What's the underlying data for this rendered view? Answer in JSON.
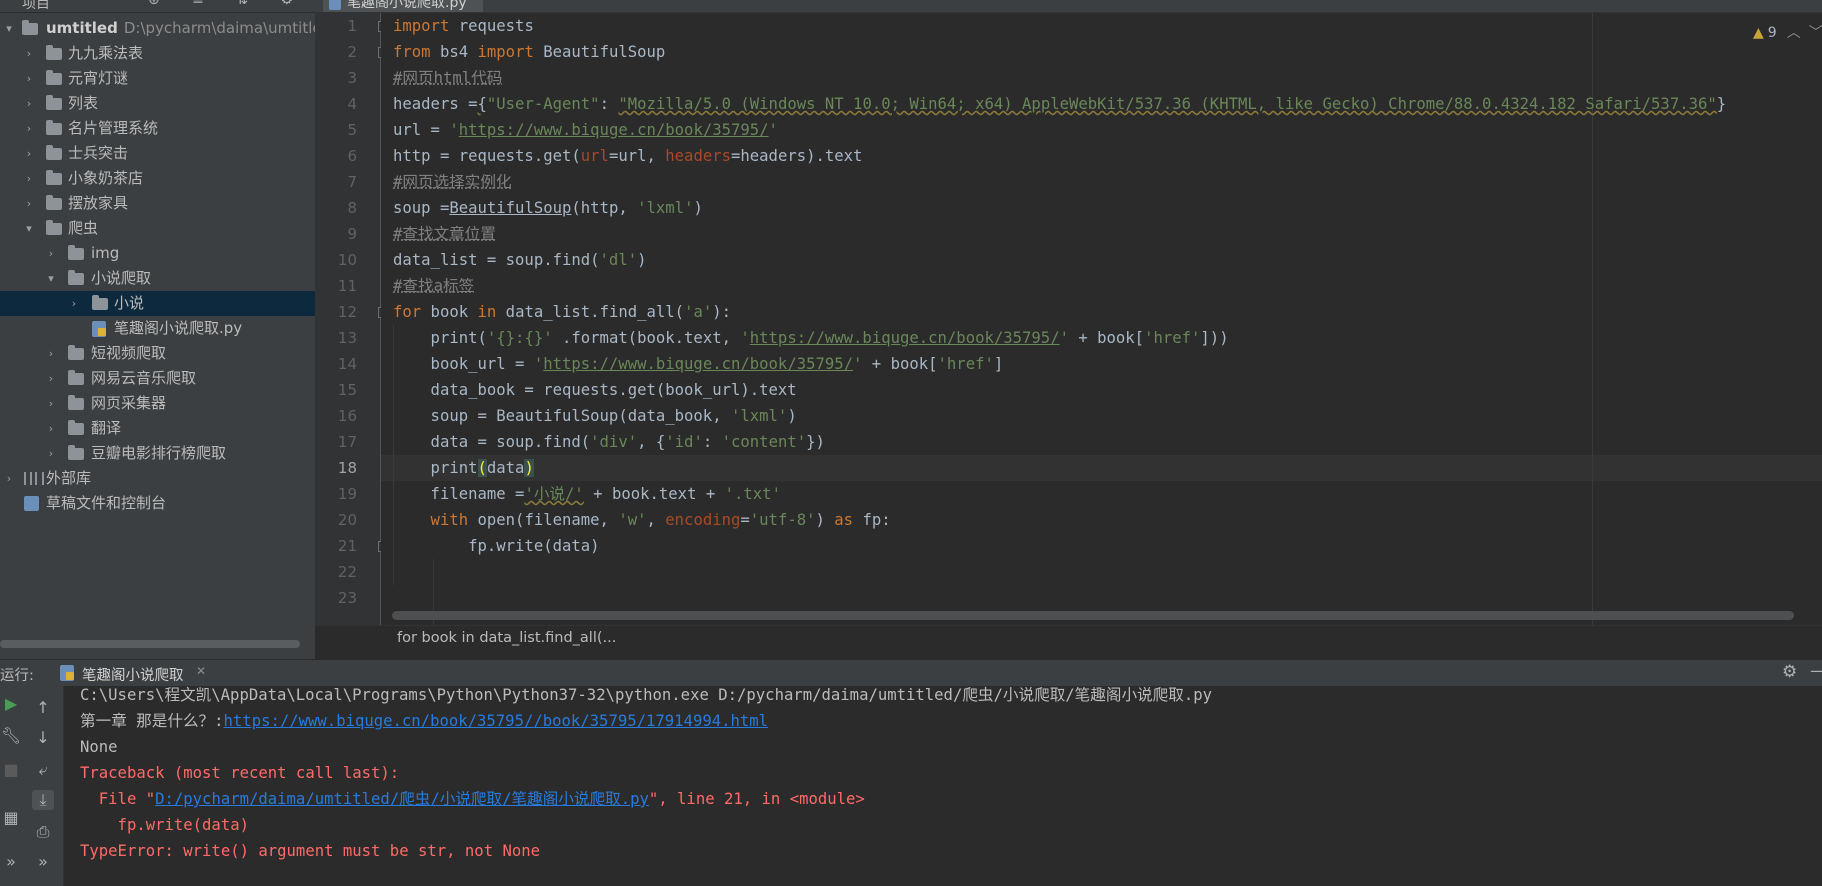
{
  "project": {
    "header_label": "项目",
    "header_icons": "⊕ ≡ ⇅ ⚙ —",
    "root_name": "umtitled",
    "root_path": "D:\\pycharm\\daima\\umtitled",
    "items": [
      {
        "label": "九九乘法表"
      },
      {
        "label": "元宵灯谜"
      },
      {
        "label": "列表"
      },
      {
        "label": "名片管理系统"
      },
      {
        "label": "士兵突击"
      },
      {
        "label": "小象奶茶店"
      },
      {
        "label": "摆放家具"
      },
      {
        "label": "爬虫"
      },
      {
        "label": "img"
      },
      {
        "label": "小说爬取"
      },
      {
        "label": "小说"
      },
      {
        "label": "笔趣阁小说爬取.py"
      },
      {
        "label": "短视频爬取"
      },
      {
        "label": "网易云音乐爬取"
      },
      {
        "label": "网页采集器"
      },
      {
        "label": "翻译"
      },
      {
        "label": "豆瓣电影排行榜爬取"
      },
      {
        "label": "外部库"
      },
      {
        "label": "草稿文件和控制台"
      }
    ]
  },
  "editor": {
    "tab_label": "笔趣阁小说爬取.py",
    "inspection_count": "9",
    "current_line": 18,
    "line_numbers": [
      "1",
      "2",
      "3",
      "4",
      "5",
      "6",
      "7",
      "8",
      "9",
      "10",
      "11",
      "12",
      "13",
      "14",
      "15",
      "16",
      "17",
      "18",
      "19",
      "20",
      "21",
      "22",
      "23"
    ],
    "code": {
      "l1_kw": "import",
      "l1_rest": " requests",
      "l2_kw1": "from",
      "l2_mid": " bs4 ",
      "l2_kw2": "import",
      "l2_rest": " BeautifulSoup",
      "l3": "#网页html代码",
      "l4_a": "headers =",
      "l4_b": "{",
      "l4_key": "\"User-Agent\"",
      "l4_c": ": ",
      "l4_val": "\"Mozilla/5.0 (Windows NT 10.0; Win64; x64) AppleWebKit/537.36 (KHTML, like Gecko) Chrome/88.0.4324.182 Safari/537.36\"",
      "l4_d": "}",
      "l5_a": "url = ",
      "l5_q1": "'",
      "l5_url": "https://www.biquge.cn/book/35795/",
      "l5_q2": "'",
      "l6_a": "http = requests.get(",
      "l6_p1": "url",
      "l6_b": "=url, ",
      "l6_p2": "headers",
      "l6_c": "=headers).text",
      "l7": "#网页选择实例化",
      "l8_a": "soup =",
      "l8_b": "BeautifulSoup",
      "l8_c": "(http, ",
      "l8_s": "'lxml'",
      "l8_d": ")",
      "l9": "#查找文章位置",
      "l10_a": "data_list = soup.find(",
      "l10_s": "'dl'",
      "l10_b": ")",
      "l11": "#查找a标签",
      "l12_kw1": "for",
      "l12_a": " book ",
      "l12_kw2": "in",
      "l12_b": " data_list.find_all(",
      "l12_s": "'a'",
      "l12_c": "):",
      "l13_a": "    print(",
      "l13_s1": "'{}:{}'",
      "l13_b": " .format(book.text, ",
      "l13_q1": "'",
      "l13_url": "https://www.biquge.cn/book/35795/",
      "l13_q2": "'",
      "l13_c": " + book[",
      "l13_s2": "'href'",
      "l13_d": "]))",
      "l14_a": "    book_url = ",
      "l14_q1": "'",
      "l14_url": "https://www.biquge.cn/book/35795/",
      "l14_q2": "'",
      "l14_b": " + book[",
      "l14_s": "'href'",
      "l14_c": "]",
      "l15": "    data_book = requests.get(book_url).text",
      "l16_a": "    soup = BeautifulSoup(data_book, ",
      "l16_s": "'lxml'",
      "l16_b": ")",
      "l17_a": "    data = soup.find(",
      "l17_s1": "'div'",
      "l17_b": ", {",
      "l17_s2": "'id'",
      "l17_c": ": ",
      "l17_s3": "'content'",
      "l17_d": "})",
      "l18_a": "    print",
      "l18_p1": "(",
      "l18_b": "data",
      "l18_p2": ")",
      "l19_a": "    filename =",
      "l19_s1": "'小说/'",
      "l19_b": " + book.text + ",
      "l19_s2": "'.txt'",
      "l20_kw1": "    with",
      "l20_a": " open(filename, ",
      "l20_s1": "'w'",
      "l20_b": ", ",
      "l20_p": "encoding",
      "l20_c": "=",
      "l20_s2": "'utf-8'",
      "l20_d": ") ",
      "l20_kw2": "as",
      "l20_e": " fp:",
      "l21": "        fp.write(data)"
    },
    "breadcrumb": "for book in data_list.find_all(..."
  },
  "run": {
    "label": "运行:",
    "tab_label": "笔趣阁小说爬取",
    "console": {
      "line1": "C:\\Users\\程文凯\\AppData\\Local\\Programs\\Python\\Python37-32\\python.exe D:/pycharm/daima/umtitled/爬虫/小说爬取/笔趣阁小说爬取.py",
      "line2_text": "第一章 那是什么？:",
      "line2_link": "https://www.biquge.cn/book/35795//book/35795/17914994.html",
      "line3": "None",
      "line4": "Traceback (most recent call last):",
      "line5_a": "  File \"",
      "line5_link": "D:/pycharm/daima/umtitled/爬虫/小说爬取/笔趣阁小说爬取.py",
      "line5_b": "\", line 21, in <module>",
      "line6": "    fp.write(data)",
      "line7": "TypeError: write() argument must be str, not None"
    }
  },
  "colors": {
    "background": "#2b2b2b",
    "panel": "#3c3f41",
    "keyword": "#cc7832",
    "string": "#6a8759",
    "comment": "#808080",
    "error": "#ff6b68",
    "link": "#287bde",
    "selection": "#0d293e"
  },
  "icons": {
    "folder": "folder-icon",
    "python_file": "python-file-icon",
    "settings": "gear-icon",
    "run": "play-icon"
  }
}
